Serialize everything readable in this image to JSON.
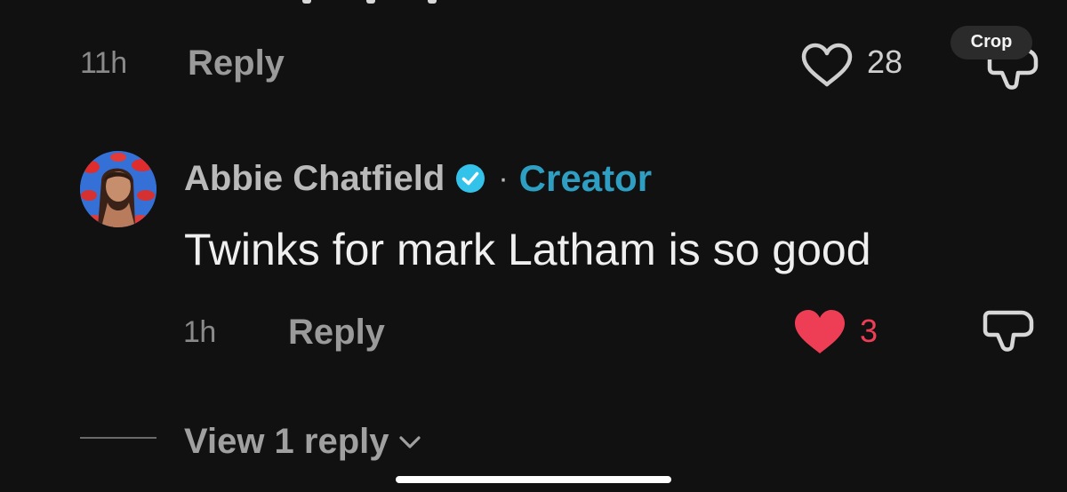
{
  "top_comment": {
    "time": "11h",
    "reply_label": "Reply",
    "like_count": "28"
  },
  "toolbar": {
    "crop_label": "Crop"
  },
  "comment": {
    "author": "Abbie Chatfield",
    "separator": "·",
    "role_label": "Creator",
    "text": "Twinks for mark Latham is so good",
    "time": "1h",
    "reply_label": "Reply",
    "like_count": "3",
    "liked": true
  },
  "replies": {
    "view_label": "View 1 reply"
  },
  "colors": {
    "background": "#111111",
    "creator_accent": "#2e9fc3",
    "liked_heart": "#ee3e56",
    "verified_badge": "#33c3ea"
  },
  "icons": {
    "like_empty": "heart-outline-icon",
    "like_filled": "heart-filled-icon",
    "dislike": "thumbs-down-icon",
    "verified": "verified-badge-icon",
    "expand": "chevron-down-icon"
  }
}
